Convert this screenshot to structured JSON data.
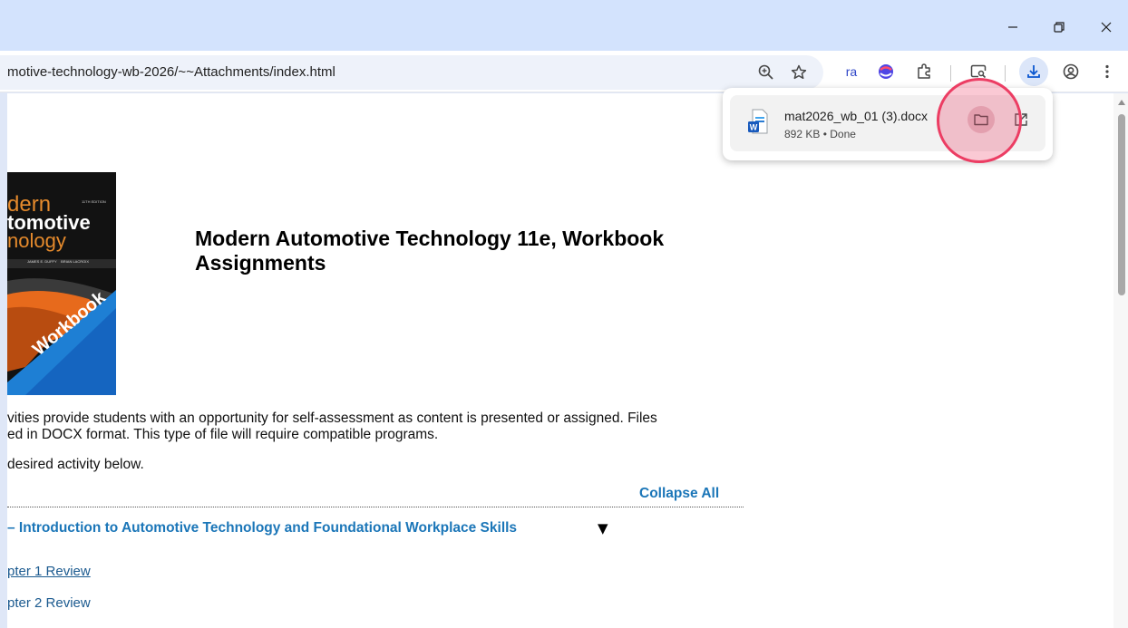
{
  "browser": {
    "url_visible": "motive-technology-wb-2026/~~Attachments/index.html",
    "extension_text": "ra",
    "window_controls": [
      "minimize-icon",
      "restore-icon",
      "close-icon"
    ],
    "toolbar_icons": [
      "zoom-icon",
      "bookmark-star-icon",
      "extension-ra-icon",
      "extension-color-icon",
      "extensions-puzzle-icon",
      "screen-search-icon",
      "download-icon",
      "profile-icon",
      "menu-icon"
    ],
    "accent_color": "#0b57d0"
  },
  "download": {
    "filename": "mat2026_wb_01 (3).docx",
    "meta": "892 KB • Done",
    "actions": [
      "folder-icon",
      "open-external-icon"
    ]
  },
  "page": {
    "cover_lines": [
      "dern",
      "tomotive",
      "nology"
    ],
    "cover_edition": "11TH EDITION",
    "cover_authors": [
      "JAMES E. DUFFY",
      "BRIAN LACROIX"
    ],
    "cover_badge": "Workbook",
    "title": "Modern Automotive Technology 11e, Workbook Assignments",
    "desc_line1": "vities provide students with an opportunity for self-assessment as content is presented or assigned. Files",
    "desc_line2": "ed in DOCX format. This type of file will require compatible programs.",
    "desc_line3": " desired activity below.",
    "collapse_label": "Collapse All",
    "section_label": " – Introduction to Automotive Technology and Foundational Workplace Skills",
    "section_caret": "▼",
    "chapters": [
      "pter 1 Review",
      "pter 2 Review"
    ],
    "link_color": "#1b76b8"
  },
  "highlight_color": "#ec3d63"
}
